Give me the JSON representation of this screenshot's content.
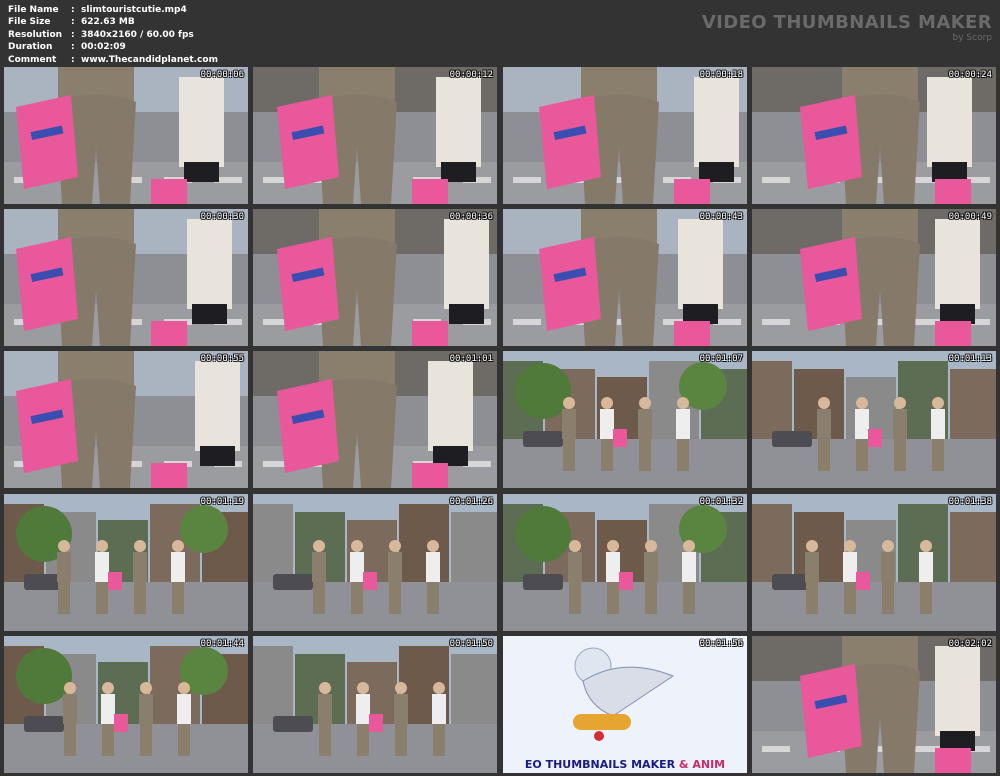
{
  "meta": {
    "rows": [
      {
        "label": "File Name",
        "value": "slimtouristcutie.mp4"
      },
      {
        "label": "File Size",
        "value": "622.63 MB"
      },
      {
        "label": "Resolution",
        "value": "3840x2160 / 60.00 fps"
      },
      {
        "label": "Duration",
        "value": "00:02:09"
      },
      {
        "label": "Comment",
        "value": "www.Thecandidplanet.com"
      }
    ],
    "separator": ":"
  },
  "brand": {
    "title": "VIDEO THUMBNAILS MAKER",
    "byline": "by Scorp"
  },
  "colors": {
    "background": "#333333",
    "header_text": "#ffffff",
    "brand_text": "#6a6a6a",
    "bag_pink": "#e8589a"
  },
  "thumbnails": [
    {
      "time": "00:00:06"
    },
    {
      "time": "00:00:12"
    },
    {
      "time": "00:00:18"
    },
    {
      "time": "00:00:24"
    },
    {
      "time": "00:00:30"
    },
    {
      "time": "00:00:36"
    },
    {
      "time": "00:00:43"
    },
    {
      "time": "00:00:49"
    },
    {
      "time": "00:00:55"
    },
    {
      "time": "00:01:01"
    },
    {
      "time": "00:01:07"
    },
    {
      "time": "00:01:13"
    },
    {
      "time": "00:01:19"
    },
    {
      "time": "00:01:26"
    },
    {
      "time": "00:01:32"
    },
    {
      "time": "00:01:38"
    },
    {
      "time": "00:01:44"
    },
    {
      "time": "00:01:50"
    },
    {
      "time": "00:01:56"
    },
    {
      "time": "00:02:02"
    }
  ],
  "promo": {
    "text_a": "EO THUMBNAILS MAKER ",
    "text_b": "& ANIM"
  }
}
